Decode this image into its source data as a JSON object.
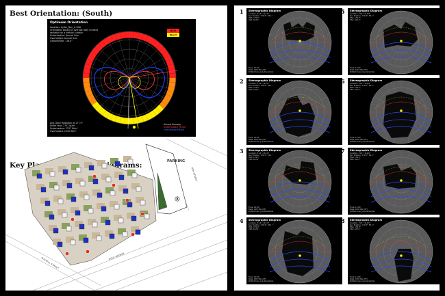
{
  "left": {
    "title": "Best Orientation: (South)",
    "key_plan_title": "Key Plan for Sun Path Diagrams:"
  },
  "orientation_chart": {
    "heading": "Optimum Orientation",
    "info": [
      "Location: Hyder_Don_IL USA",
      "Orientation based on average daily incident",
      "radiation on a vertical surface",
      "Underheated: Annual Sum",
      "Overheated: Annual Sum",
      "Compromise: 178.0°"
    ],
    "legend": [
      "Best",
      "Worst"
    ],
    "stats": [
      "Avg. Daily Radiation at 177.5°",
      "Entire Year: 2751 W/m²",
      "Underheated: 1237 W/m²",
      "Overheated: 1545 W/m²"
    ],
    "key": [
      "Annual Average",
      "Underheated Period",
      "Overheated Period"
    ],
    "colors": {
      "ring_top": "#ff2020",
      "ring_bottom": "#ffee00",
      "blue": "#1b3cff",
      "red": "#ff3030"
    }
  },
  "key_plan": {
    "parking": "PARKING",
    "roads": [
      "RUSSELL STREET",
      "OHIO AVENUE",
      "9TH STREET"
    ],
    "markers": [
      "1",
      "2",
      "3",
      "4",
      "5",
      "6",
      "7",
      "8"
    ]
  },
  "sun_diagrams": [
    {
      "number": "1",
      "heading": "Stereographic Diagram",
      "info": [
        "Location: 31.4°, 112.9°",
        "Sun Position: 179.3°, 83.1°",
        "HSA: 179.3°",
        "VSA: 102.2°"
      ],
      "footer": [
        "Time: 12:00",
        "Date: 10th Mar (DF)",
        "Dotted lines: July-December"
      ]
    },
    {
      "number": "5",
      "heading": "Stereographic Diagram",
      "info": [
        "Location: 31.4°, 112.9°",
        "Sun Position: 179.3°, 83.1°",
        "HSA: 179.3°",
        "VSA: 102.2°"
      ],
      "footer": [
        "Time: 12:00",
        "Date: 10th Mar (DF)",
        "Dotted lines: July-December"
      ]
    },
    {
      "number": "2",
      "heading": "Stereographic Diagram",
      "info": [
        "Location: 31.4°, 112.9°",
        "Sun Position: 179.3°, 83.1°",
        "HSA: 179.3°",
        "VSA: 102.2°"
      ],
      "footer": [
        "Time: 12:00",
        "Date: 10th Mar (DF)",
        "Dotted lines: July-December"
      ]
    },
    {
      "number": "6",
      "heading": "Stereographic Diagram",
      "info": [
        "Location: 31.4°, 112.9°",
        "Sun Position: 179.3°, 83.1°",
        "HSA: 179.3°",
        "VSA: 102.2°"
      ],
      "footer": [
        "Time: 12:00",
        "Date: 10th Mar (DF)",
        "Dotted lines: July-December"
      ]
    },
    {
      "number": "3",
      "heading": "Stereographic Diagram",
      "info": [
        "Location: 31.4°, 112.9°",
        "Sun Position: 179.3°, 83.1°",
        "HSA: 179.3°",
        "VSA: 102.2°"
      ],
      "footer": [
        "Time: 12:00",
        "Date: 10th Mar (DF)",
        "Dotted lines: July-December"
      ]
    },
    {
      "number": "7",
      "heading": "Stereographic Diagram",
      "info": [
        "Location: 31.4°, 112.9°",
        "Sun Position: 179.3°, 83.1°",
        "HSA: 179.3°",
        "VSA: 102.2°"
      ],
      "footer": [
        "Time: 12:00",
        "Date: 10th Mar (DF)",
        "Dotted lines: July-December"
      ]
    },
    {
      "number": "4",
      "heading": "Stereographic Diagram",
      "info": [
        "Location: 31.4°, 112.9°",
        "Sun Position: 179.3°, 83.1°",
        "HSA: 179.3°",
        "VSA: 102.2°"
      ],
      "footer": [
        "Time: 12:00",
        "Date: 10th Mar (DF)",
        "Dotted lines: July-December"
      ]
    },
    {
      "number": "8",
      "heading": "Stereographic Diagram",
      "info": [
        "Location: 31.4°, 112.9°",
        "Sun Position: 179.3°, 83.1°",
        "HSA: 179.3°",
        "VSA: 102.2°"
      ],
      "footer": [
        "Time: 12:00",
        "Date: 10th Mar (DF)",
        "Dotted lines: July-December"
      ]
    }
  ]
}
